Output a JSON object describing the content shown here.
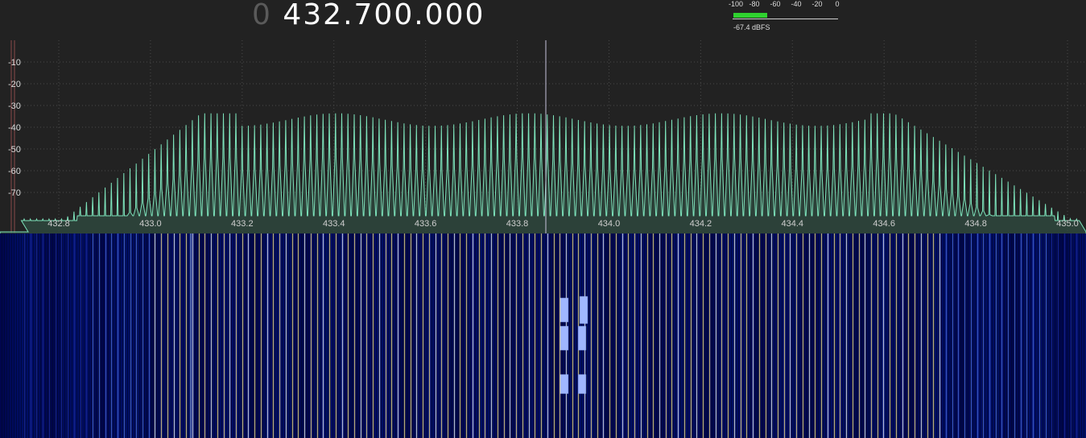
{
  "frequency": {
    "leading_digit": "0",
    "value": "432.700.000"
  },
  "smeter": {
    "scale_labels": [
      "-100",
      "-80",
      "-60",
      "-40",
      "-20",
      "0"
    ],
    "readout": "-67.4 dBFS",
    "level_dbfs": -67.4,
    "bar_color": "#2fd12f"
  },
  "spectrum": {
    "db_labels": [
      "-10",
      "-20",
      "-30",
      "-40",
      "-50",
      "-60",
      "-70"
    ],
    "freq_labels": [
      "432.8",
      "433.0",
      "433.2",
      "433.4",
      "433.6",
      "433.8",
      "434.0",
      "434.2",
      "434.4",
      "434.6",
      "434.8",
      "435.0"
    ],
    "trace_color": "#7de3bb",
    "fill_color": "#2f4a40",
    "marker_color": "#c7c2dc",
    "grid_color": "#4a4a4a"
  },
  "waterfall": {
    "background_color": "#000833",
    "line_color": "#f2df8a"
  }
}
